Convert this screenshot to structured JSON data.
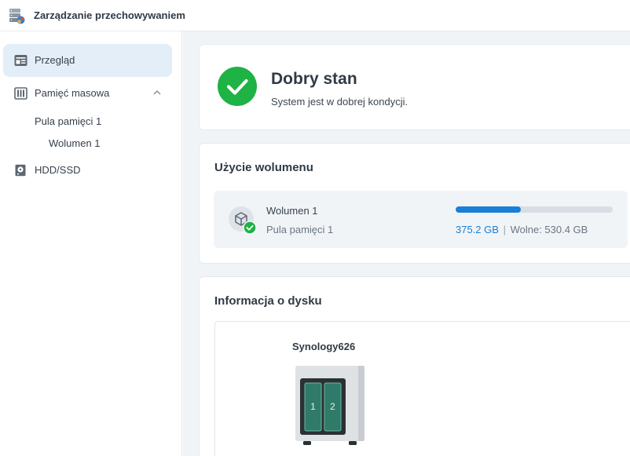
{
  "app": {
    "title": "Zarządzanie przechowywaniem",
    "icon": "storage-manager-icon"
  },
  "sidebar": {
    "items": [
      {
        "label": "Przegląd",
        "icon": "overview-icon",
        "active": true
      },
      {
        "label": "Pamięć masowa",
        "icon": "storage-icon",
        "expanded": true
      },
      {
        "label": "HDD/SSD",
        "icon": "drive-icon"
      }
    ],
    "sub_items": [
      {
        "label": "Pula pamięci 1"
      },
      {
        "label": "Wolumen 1"
      }
    ]
  },
  "status": {
    "title": "Dobry stan",
    "subtitle": "System jest w dobrej kondycji.",
    "color": "#1fb244"
  },
  "usage": {
    "section_title": "Użycie wolumenu",
    "volume": {
      "name": "Wolumen 1",
      "pool": "Pula pamięci 1",
      "used": "375.2 GB",
      "separator": "|",
      "free": "Wolne: 530.4 GB",
      "used_fraction": 0.414,
      "bar_color": "#1a7fd6"
    }
  },
  "disk_info": {
    "section_title": "Informacja o dysku",
    "device": "Synology626",
    "bays": [
      "1",
      "2"
    ]
  }
}
